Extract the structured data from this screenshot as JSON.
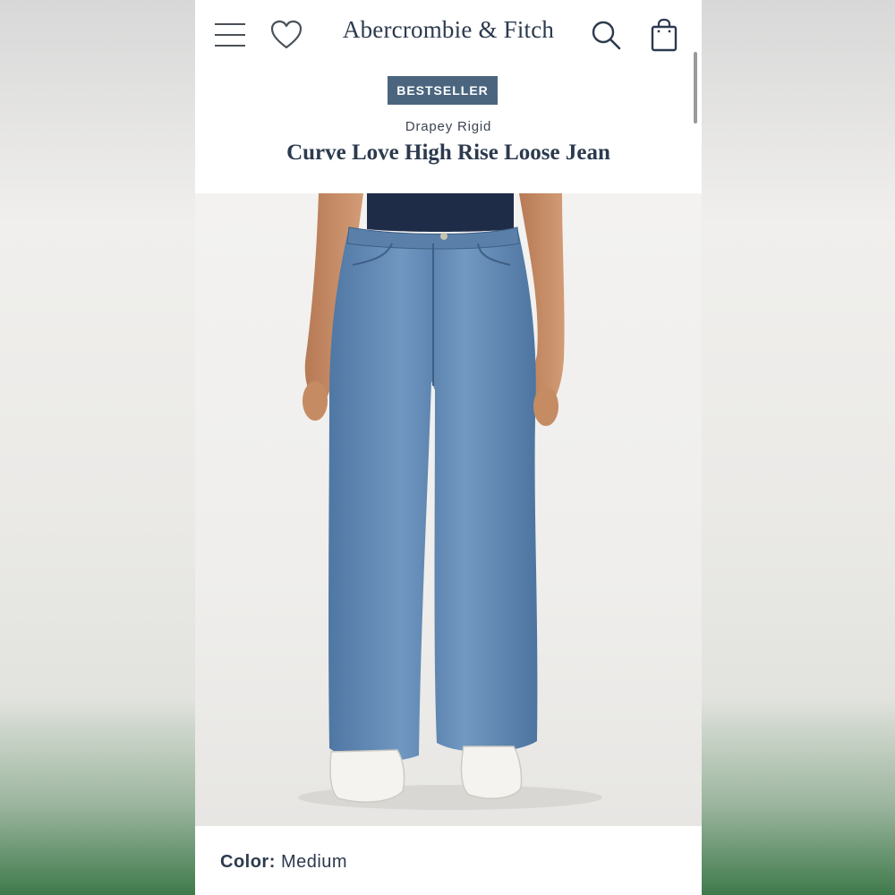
{
  "header": {
    "brand": "Abercrombie & Fitch",
    "icons": [
      "menu-icon",
      "heart-icon",
      "search-icon",
      "shopping-bag-icon"
    ]
  },
  "product": {
    "badge": "BESTSELLER",
    "subtitle": "Drapey Rigid",
    "title": "Curve Love High Rise Loose Jean",
    "color_label": "Color:",
    "color_value": "Medium"
  },
  "colors": {
    "brand_text": "#2c3a4e",
    "badge_bg": "#4b657f",
    "denim": "#5f88b3"
  }
}
